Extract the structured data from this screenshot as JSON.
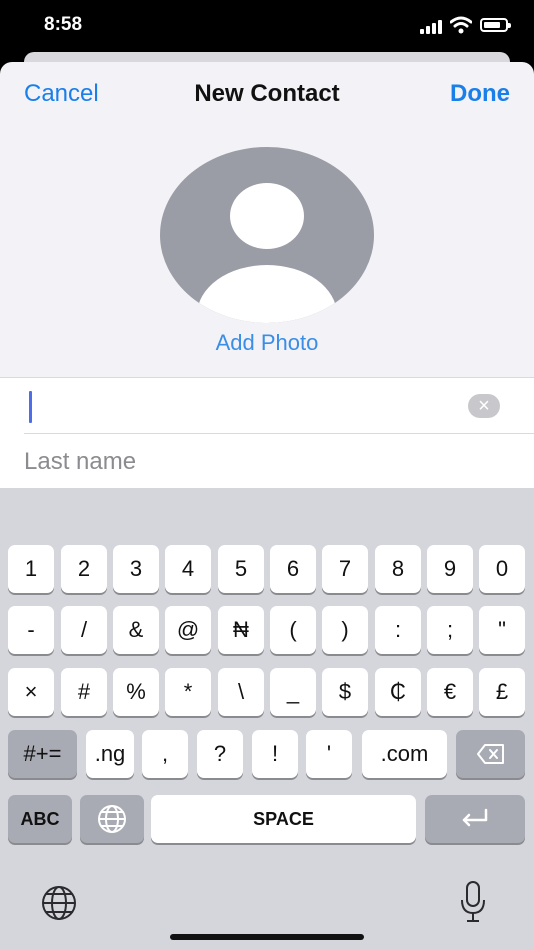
{
  "status_bar": {
    "time": "8:58"
  },
  "nav": {
    "cancel": "Cancel",
    "title": "New Contact",
    "done": "Done"
  },
  "photo": {
    "add_label": "Add Photo"
  },
  "fields": {
    "first_name_value": "",
    "last_name_placeholder": "Last name"
  },
  "keyboard": {
    "row1": [
      "1",
      "2",
      "3",
      "4",
      "5",
      "6",
      "7",
      "8",
      "9",
      "0"
    ],
    "row2": [
      "-",
      "/",
      "&",
      "@",
      "₦",
      "(",
      ")",
      ":",
      ";",
      "\""
    ],
    "row3": [
      "×",
      "#",
      "%",
      "*",
      "\\",
      "_",
      "$",
      "₵",
      "€",
      "£"
    ],
    "row4": {
      "shift": "#+=",
      "keys": [
        ".ng",
        ",",
        "?",
        "!",
        "'",
        ".com"
      ]
    },
    "row5": {
      "abc": "ABC",
      "space": "SPACE"
    }
  },
  "icons": {
    "globe": "globe-icon",
    "mic": "microphone-icon",
    "delete": "backspace-icon",
    "return": "return-icon",
    "clear": "clear-icon"
  },
  "colors": {
    "accent": "#1a7fe8",
    "keyboard_bg": "#d4d6dc",
    "dark_key": "#a8abb3"
  }
}
